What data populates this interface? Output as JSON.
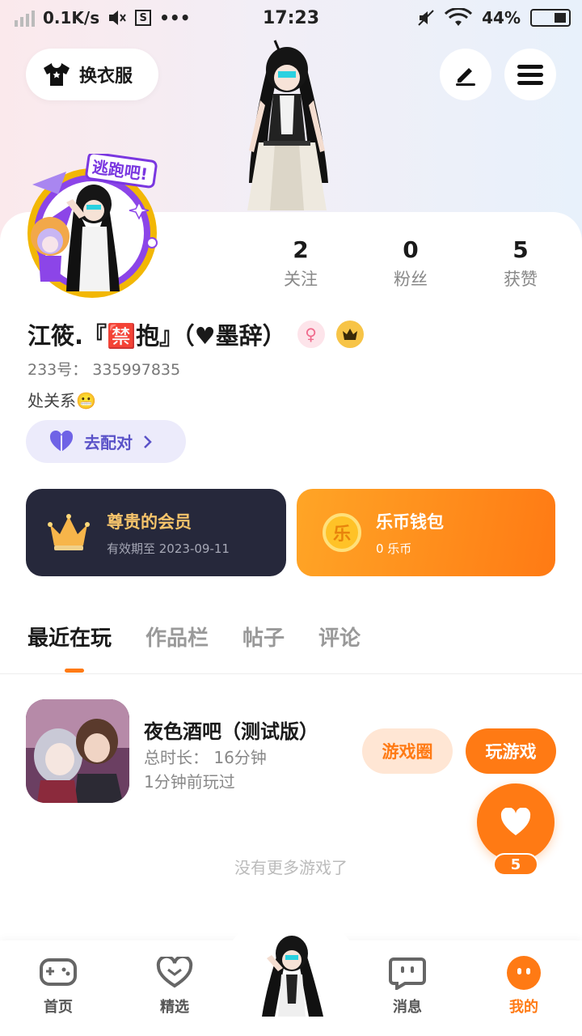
{
  "status_bar": {
    "net_speed": "0.1K/s",
    "time": "17:23",
    "battery": "44%"
  },
  "top": {
    "dress_label": "换衣服"
  },
  "stats": [
    {
      "value": "2",
      "label": "关注"
    },
    {
      "value": "0",
      "label": "粉丝"
    },
    {
      "value": "5",
      "label": "获赞"
    }
  ],
  "profile": {
    "name": "江筱.『🈲抱』（♥墨辞）",
    "uid": "233号： 335997835",
    "bio": "处关系😬",
    "match_label": "去配对"
  },
  "vip": {
    "title": "尊贵的会员",
    "subtitle": "有效期至 2023-09-11"
  },
  "wallet": {
    "title": "乐币钱包",
    "subtitle": "0 乐币",
    "coin_glyph": "乐"
  },
  "tabs": [
    "最近在玩",
    "作品栏",
    "帖子",
    "评论"
  ],
  "game": {
    "title": "夜色酒吧（测试版）",
    "duration": "总时长： 16分钟",
    "last_played": "1分钟前玩过",
    "circle_label": "游戏圈",
    "play_label": "玩游戏"
  },
  "like_count": "5",
  "no_more": "没有更多游戏了",
  "nav": {
    "home": "首页",
    "featured": "精选",
    "messages": "消息",
    "mine": "我的"
  },
  "colors": {
    "accent": "#ff7a14",
    "vip_bg": "#26283b",
    "vip_gold": "#f6c46b",
    "match": "#5a52c8"
  }
}
